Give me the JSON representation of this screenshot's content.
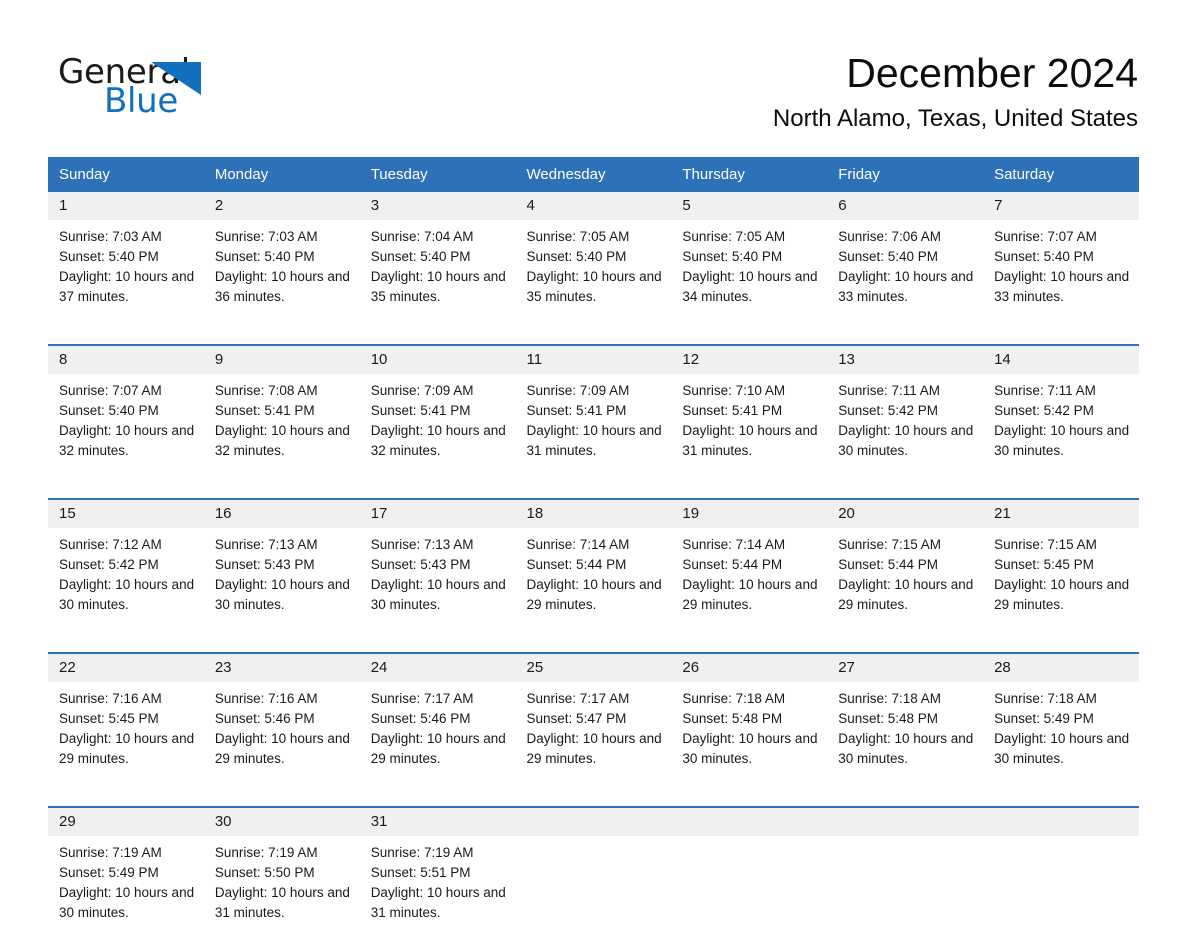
{
  "brand": {
    "name_dark": "General",
    "name_blue": "Blue",
    "accent_color": "#1270c0",
    "logo_icon": "triangle-logo-icon"
  },
  "header": {
    "title": "December 2024",
    "subtitle": "North Alamo, Texas, United States"
  },
  "theme": {
    "header_blue": "#2d72b8",
    "daynum_band": "#f0f0f0",
    "text": "#1a1a1a"
  },
  "weekday_headers": [
    "Sunday",
    "Monday",
    "Tuesday",
    "Wednesday",
    "Thursday",
    "Friday",
    "Saturday"
  ],
  "weeks": [
    {
      "days": [
        {
          "num": "1",
          "sunrise": "Sunrise: 7:03 AM",
          "sunset": "Sunset: 5:40 PM",
          "daylight": "Daylight: 10 hours and 37 minutes."
        },
        {
          "num": "2",
          "sunrise": "Sunrise: 7:03 AM",
          "sunset": "Sunset: 5:40 PM",
          "daylight": "Daylight: 10 hours and 36 minutes."
        },
        {
          "num": "3",
          "sunrise": "Sunrise: 7:04 AM",
          "sunset": "Sunset: 5:40 PM",
          "daylight": "Daylight: 10 hours and 35 minutes."
        },
        {
          "num": "4",
          "sunrise": "Sunrise: 7:05 AM",
          "sunset": "Sunset: 5:40 PM",
          "daylight": "Daylight: 10 hours and 35 minutes."
        },
        {
          "num": "5",
          "sunrise": "Sunrise: 7:05 AM",
          "sunset": "Sunset: 5:40 PM",
          "daylight": "Daylight: 10 hours and 34 minutes."
        },
        {
          "num": "6",
          "sunrise": "Sunrise: 7:06 AM",
          "sunset": "Sunset: 5:40 PM",
          "daylight": "Daylight: 10 hours and 33 minutes."
        },
        {
          "num": "7",
          "sunrise": "Sunrise: 7:07 AM",
          "sunset": "Sunset: 5:40 PM",
          "daylight": "Daylight: 10 hours and 33 minutes."
        }
      ]
    },
    {
      "days": [
        {
          "num": "8",
          "sunrise": "Sunrise: 7:07 AM",
          "sunset": "Sunset: 5:40 PM",
          "daylight": "Daylight: 10 hours and 32 minutes."
        },
        {
          "num": "9",
          "sunrise": "Sunrise: 7:08 AM",
          "sunset": "Sunset: 5:41 PM",
          "daylight": "Daylight: 10 hours and 32 minutes."
        },
        {
          "num": "10",
          "sunrise": "Sunrise: 7:09 AM",
          "sunset": "Sunset: 5:41 PM",
          "daylight": "Daylight: 10 hours and 32 minutes."
        },
        {
          "num": "11",
          "sunrise": "Sunrise: 7:09 AM",
          "sunset": "Sunset: 5:41 PM",
          "daylight": "Daylight: 10 hours and 31 minutes."
        },
        {
          "num": "12",
          "sunrise": "Sunrise: 7:10 AM",
          "sunset": "Sunset: 5:41 PM",
          "daylight": "Daylight: 10 hours and 31 minutes."
        },
        {
          "num": "13",
          "sunrise": "Sunrise: 7:11 AM",
          "sunset": "Sunset: 5:42 PM",
          "daylight": "Daylight: 10 hours and 30 minutes."
        },
        {
          "num": "14",
          "sunrise": "Sunrise: 7:11 AM",
          "sunset": "Sunset: 5:42 PM",
          "daylight": "Daylight: 10 hours and 30 minutes."
        }
      ]
    },
    {
      "days": [
        {
          "num": "15",
          "sunrise": "Sunrise: 7:12 AM",
          "sunset": "Sunset: 5:42 PM",
          "daylight": "Daylight: 10 hours and 30 minutes."
        },
        {
          "num": "16",
          "sunrise": "Sunrise: 7:13 AM",
          "sunset": "Sunset: 5:43 PM",
          "daylight": "Daylight: 10 hours and 30 minutes."
        },
        {
          "num": "17",
          "sunrise": "Sunrise: 7:13 AM",
          "sunset": "Sunset: 5:43 PM",
          "daylight": "Daylight: 10 hours and 30 minutes."
        },
        {
          "num": "18",
          "sunrise": "Sunrise: 7:14 AM",
          "sunset": "Sunset: 5:44 PM",
          "daylight": "Daylight: 10 hours and 29 minutes."
        },
        {
          "num": "19",
          "sunrise": "Sunrise: 7:14 AM",
          "sunset": "Sunset: 5:44 PM",
          "daylight": "Daylight: 10 hours and 29 minutes."
        },
        {
          "num": "20",
          "sunrise": "Sunrise: 7:15 AM",
          "sunset": "Sunset: 5:44 PM",
          "daylight": "Daylight: 10 hours and 29 minutes."
        },
        {
          "num": "21",
          "sunrise": "Sunrise: 7:15 AM",
          "sunset": "Sunset: 5:45 PM",
          "daylight": "Daylight: 10 hours and 29 minutes."
        }
      ]
    },
    {
      "days": [
        {
          "num": "22",
          "sunrise": "Sunrise: 7:16 AM",
          "sunset": "Sunset: 5:45 PM",
          "daylight": "Daylight: 10 hours and 29 minutes."
        },
        {
          "num": "23",
          "sunrise": "Sunrise: 7:16 AM",
          "sunset": "Sunset: 5:46 PM",
          "daylight": "Daylight: 10 hours and 29 minutes."
        },
        {
          "num": "24",
          "sunrise": "Sunrise: 7:17 AM",
          "sunset": "Sunset: 5:46 PM",
          "daylight": "Daylight: 10 hours and 29 minutes."
        },
        {
          "num": "25",
          "sunrise": "Sunrise: 7:17 AM",
          "sunset": "Sunset: 5:47 PM",
          "daylight": "Daylight: 10 hours and 29 minutes."
        },
        {
          "num": "26",
          "sunrise": "Sunrise: 7:18 AM",
          "sunset": "Sunset: 5:48 PM",
          "daylight": "Daylight: 10 hours and 30 minutes."
        },
        {
          "num": "27",
          "sunrise": "Sunrise: 7:18 AM",
          "sunset": "Sunset: 5:48 PM",
          "daylight": "Daylight: 10 hours and 30 minutes."
        },
        {
          "num": "28",
          "sunrise": "Sunrise: 7:18 AM",
          "sunset": "Sunset: 5:49 PM",
          "daylight": "Daylight: 10 hours and 30 minutes."
        }
      ]
    },
    {
      "days": [
        {
          "num": "29",
          "sunrise": "Sunrise: 7:19 AM",
          "sunset": "Sunset: 5:49 PM",
          "daylight": "Daylight: 10 hours and 30 minutes."
        },
        {
          "num": "30",
          "sunrise": "Sunrise: 7:19 AM",
          "sunset": "Sunset: 5:50 PM",
          "daylight": "Daylight: 10 hours and 31 minutes."
        },
        {
          "num": "31",
          "sunrise": "Sunrise: 7:19 AM",
          "sunset": "Sunset: 5:51 PM",
          "daylight": "Daylight: 10 hours and 31 minutes."
        },
        {
          "num": "",
          "sunrise": "",
          "sunset": "",
          "daylight": ""
        },
        {
          "num": "",
          "sunrise": "",
          "sunset": "",
          "daylight": ""
        },
        {
          "num": "",
          "sunrise": "",
          "sunset": "",
          "daylight": ""
        },
        {
          "num": "",
          "sunrise": "",
          "sunset": "",
          "daylight": ""
        }
      ]
    }
  ]
}
